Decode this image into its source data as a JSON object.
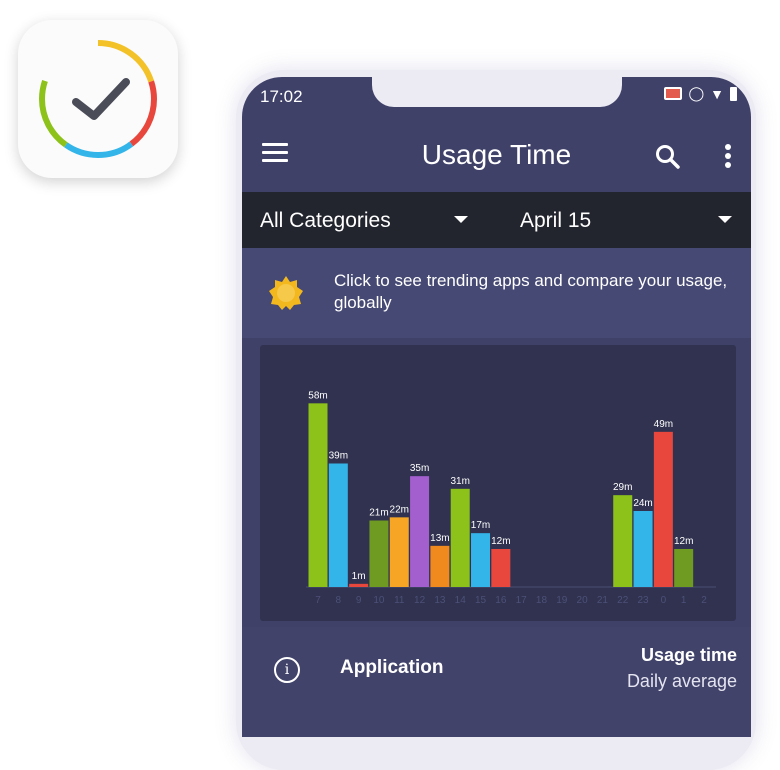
{
  "app_icon": {
    "name": "clock-check-icon"
  },
  "status_bar": {
    "time": "17:02",
    "icons": [
      "cast-icon",
      "vibrate-icon",
      "wifi-icon",
      "battery-icon"
    ]
  },
  "app_bar": {
    "title": "Usage Time",
    "menu_icon": "hamburger-icon",
    "search_icon": "search-icon",
    "more_icon": "more-vert-icon"
  },
  "filters": {
    "category": "All Categories",
    "date": "April 15"
  },
  "banner": {
    "badge_icon": "new-badge-icon",
    "text": "Click to see trending apps and compare your usage, globally"
  },
  "chart_data": {
    "type": "bar",
    "categories": [
      "7",
      "8",
      "9",
      "10",
      "11",
      "12",
      "13",
      "14",
      "15",
      "16",
      "17",
      "18",
      "19",
      "20",
      "21",
      "22",
      "23",
      "0",
      "1",
      "2"
    ],
    "values": [
      58,
      39,
      1,
      21,
      22,
      35,
      13,
      31,
      17,
      12,
      0,
      0,
      0,
      0,
      0,
      29,
      24,
      49,
      12,
      0
    ],
    "value_labels": [
      "58m",
      "39m",
      "1m",
      "21m",
      "22m",
      "35m",
      "13m",
      "31m",
      "17m",
      "12m",
      "",
      "",
      "",
      "",
      "",
      "29m",
      "24m",
      "49m",
      "12m",
      ""
    ],
    "bar_colors": [
      "#8cc21a",
      "#33b5e9",
      "#e8473e",
      "#6f9b22",
      "#f7a524",
      "#a45fcf",
      "#f08a1e",
      "#8cc21a",
      "#33b5e9",
      "#e8473e",
      "#8cc21a",
      "#8cc21a",
      "#8cc21a",
      "#8cc21a",
      "#8cc21a",
      "#8cc21a",
      "#33b5e9",
      "#e8473e",
      "#6f9b22",
      "#8cc21a"
    ],
    "ylim": [
      0,
      60
    ],
    "grid": false,
    "xlabel": "",
    "ylabel": ""
  },
  "table_header": {
    "info_icon": "info-icon",
    "application": "Application",
    "usage_time": "Usage time",
    "daily_average": "Daily average"
  }
}
